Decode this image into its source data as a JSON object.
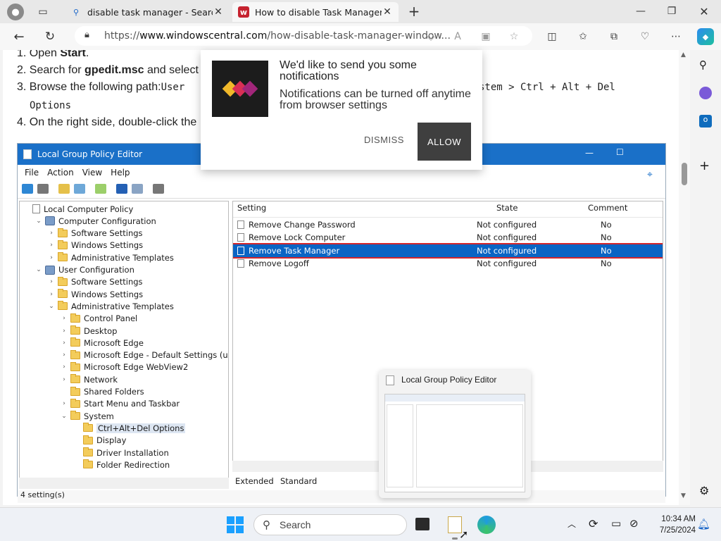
{
  "browser": {
    "tabs": [
      {
        "title": "disable task manager - Search",
        "active": false
      },
      {
        "title": "How to disable Task Manager on",
        "active": true
      }
    ],
    "url_prefix": "https://",
    "url_domain": "www.windowscentral.com",
    "url_path": "/how-disable-task-manager-window..."
  },
  "article": {
    "step1": "1. Open ",
    "step1_bold": "Start",
    "step1_end": ".",
    "step2": "2. Search for ",
    "step2_bold": "gpedit.msc",
    "step2_end": " and select",
    "step3": "3. Browse the following path:",
    "step3_mono": "User",
    "step3_mono_right": "stem > Ctrl + Alt + Del",
    "step3_cont": "Options",
    "step4": "4. On the right side, double-click the"
  },
  "notification": {
    "heading": "We'd like to send you some notifications",
    "body": "Notifications can be turned off anytime from browser settings",
    "dismiss": "DISMISS",
    "allow": "ALLOW"
  },
  "gpedit": {
    "title": "Local Group Policy Editor",
    "menu": [
      "File",
      "Action",
      "View",
      "Help"
    ],
    "tree": [
      {
        "label": "Local Computer Policy",
        "indent": 0,
        "icon": "doc",
        "chev": ""
      },
      {
        "label": "Computer Configuration",
        "indent": 1,
        "icon": "cfg",
        "chev": "v"
      },
      {
        "label": "Software Settings",
        "indent": 2,
        "icon": "folder",
        "chev": ">"
      },
      {
        "label": "Windows Settings",
        "indent": 2,
        "icon": "folder",
        "chev": ">"
      },
      {
        "label": "Administrative Templates",
        "indent": 2,
        "icon": "folder",
        "chev": ">"
      },
      {
        "label": "User Configuration",
        "indent": 1,
        "icon": "cfg",
        "chev": "v"
      },
      {
        "label": "Software Settings",
        "indent": 2,
        "icon": "folder",
        "chev": ">"
      },
      {
        "label": "Windows Settings",
        "indent": 2,
        "icon": "folder",
        "chev": ">"
      },
      {
        "label": "Administrative Templates",
        "indent": 2,
        "icon": "folder",
        "chev": "v"
      },
      {
        "label": "Control Panel",
        "indent": 3,
        "icon": "folder",
        "chev": ">"
      },
      {
        "label": "Desktop",
        "indent": 3,
        "icon": "folder",
        "chev": ">"
      },
      {
        "label": "Microsoft Edge",
        "indent": 3,
        "icon": "folder",
        "chev": ">"
      },
      {
        "label": "Microsoft Edge - Default Settings (users",
        "indent": 3,
        "icon": "folder",
        "chev": ">"
      },
      {
        "label": "Microsoft Edge WebView2",
        "indent": 3,
        "icon": "folder",
        "chev": ">"
      },
      {
        "label": "Network",
        "indent": 3,
        "icon": "folder",
        "chev": ">"
      },
      {
        "label": "Shared Folders",
        "indent": 3,
        "icon": "folder",
        "chev": ""
      },
      {
        "label": "Start Menu and Taskbar",
        "indent": 3,
        "icon": "folder",
        "chev": ">"
      },
      {
        "label": "System",
        "indent": 3,
        "icon": "folder",
        "chev": "v"
      },
      {
        "label": "Ctrl+Alt+Del Options",
        "indent": 4,
        "icon": "folder",
        "chev": "",
        "selected": true
      },
      {
        "label": "Display",
        "indent": 4,
        "icon": "folder",
        "chev": ""
      },
      {
        "label": "Driver Installation",
        "indent": 4,
        "icon": "folder",
        "chev": ""
      },
      {
        "label": "Folder Redirection",
        "indent": 4,
        "icon": "folder",
        "chev": ""
      }
    ],
    "columns": [
      "Setting",
      "State",
      "Comment"
    ],
    "rows": [
      {
        "setting": "Remove Change Password",
        "state": "Not configured",
        "comment": "No"
      },
      {
        "setting": "Remove Lock Computer",
        "state": "Not configured",
        "comment": "No"
      },
      {
        "setting": "Remove Task Manager",
        "state": "Not configured",
        "comment": "No",
        "selected": true
      },
      {
        "setting": "Remove Logoff",
        "state": "Not configured",
        "comment": "No"
      }
    ],
    "view_tabs": [
      "Extended",
      "Standard"
    ],
    "status": "4 setting(s)"
  },
  "thumbnail": {
    "title": "Local Group Policy Editor"
  },
  "taskbar": {
    "search_placeholder": "Search",
    "time": "10:34 AM",
    "date": "7/25/2024"
  }
}
